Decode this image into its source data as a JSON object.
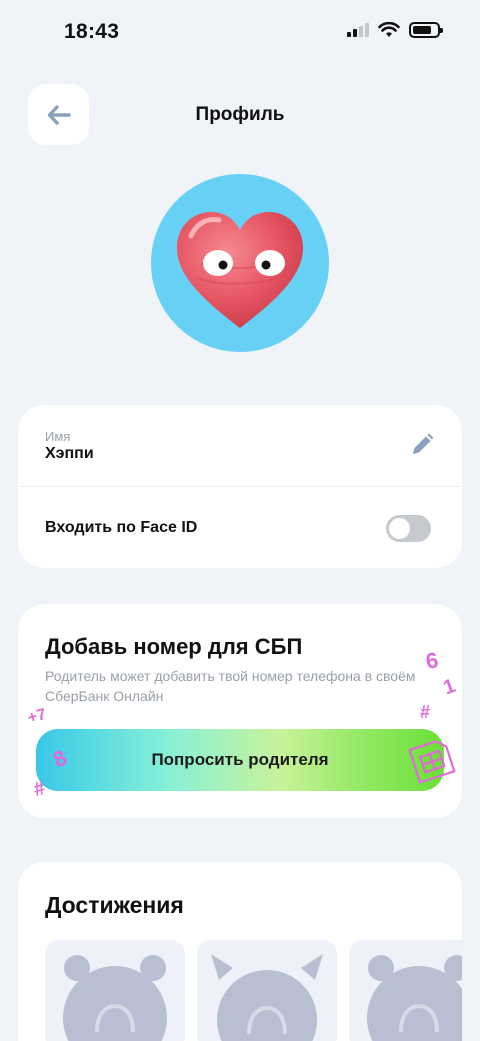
{
  "status_bar": {
    "time": "18:43"
  },
  "header": {
    "title": "Профиль"
  },
  "profile": {
    "name_label": "Имя",
    "name_value": "Хэппи",
    "face_id_label": "Входить по Face ID",
    "face_id_enabled": false
  },
  "sbp": {
    "title": "Добавь номер для СБП",
    "description": "Родитель может добавить твой номер телефона в своём СберБанк Онлайн",
    "button_label": "Попросить родителя"
  },
  "achievements": {
    "title": "Достижения"
  },
  "colors": {
    "background": "#f0f3f8",
    "avatar_bg": "#67d0f5",
    "heart": "#e8505e",
    "toggle_off": "#c6c9ce",
    "icon_blue": "#8aa1bd",
    "doodle": "#e06ad8"
  },
  "icons": {
    "back": "arrow-left-icon",
    "edit": "pencil-icon"
  }
}
